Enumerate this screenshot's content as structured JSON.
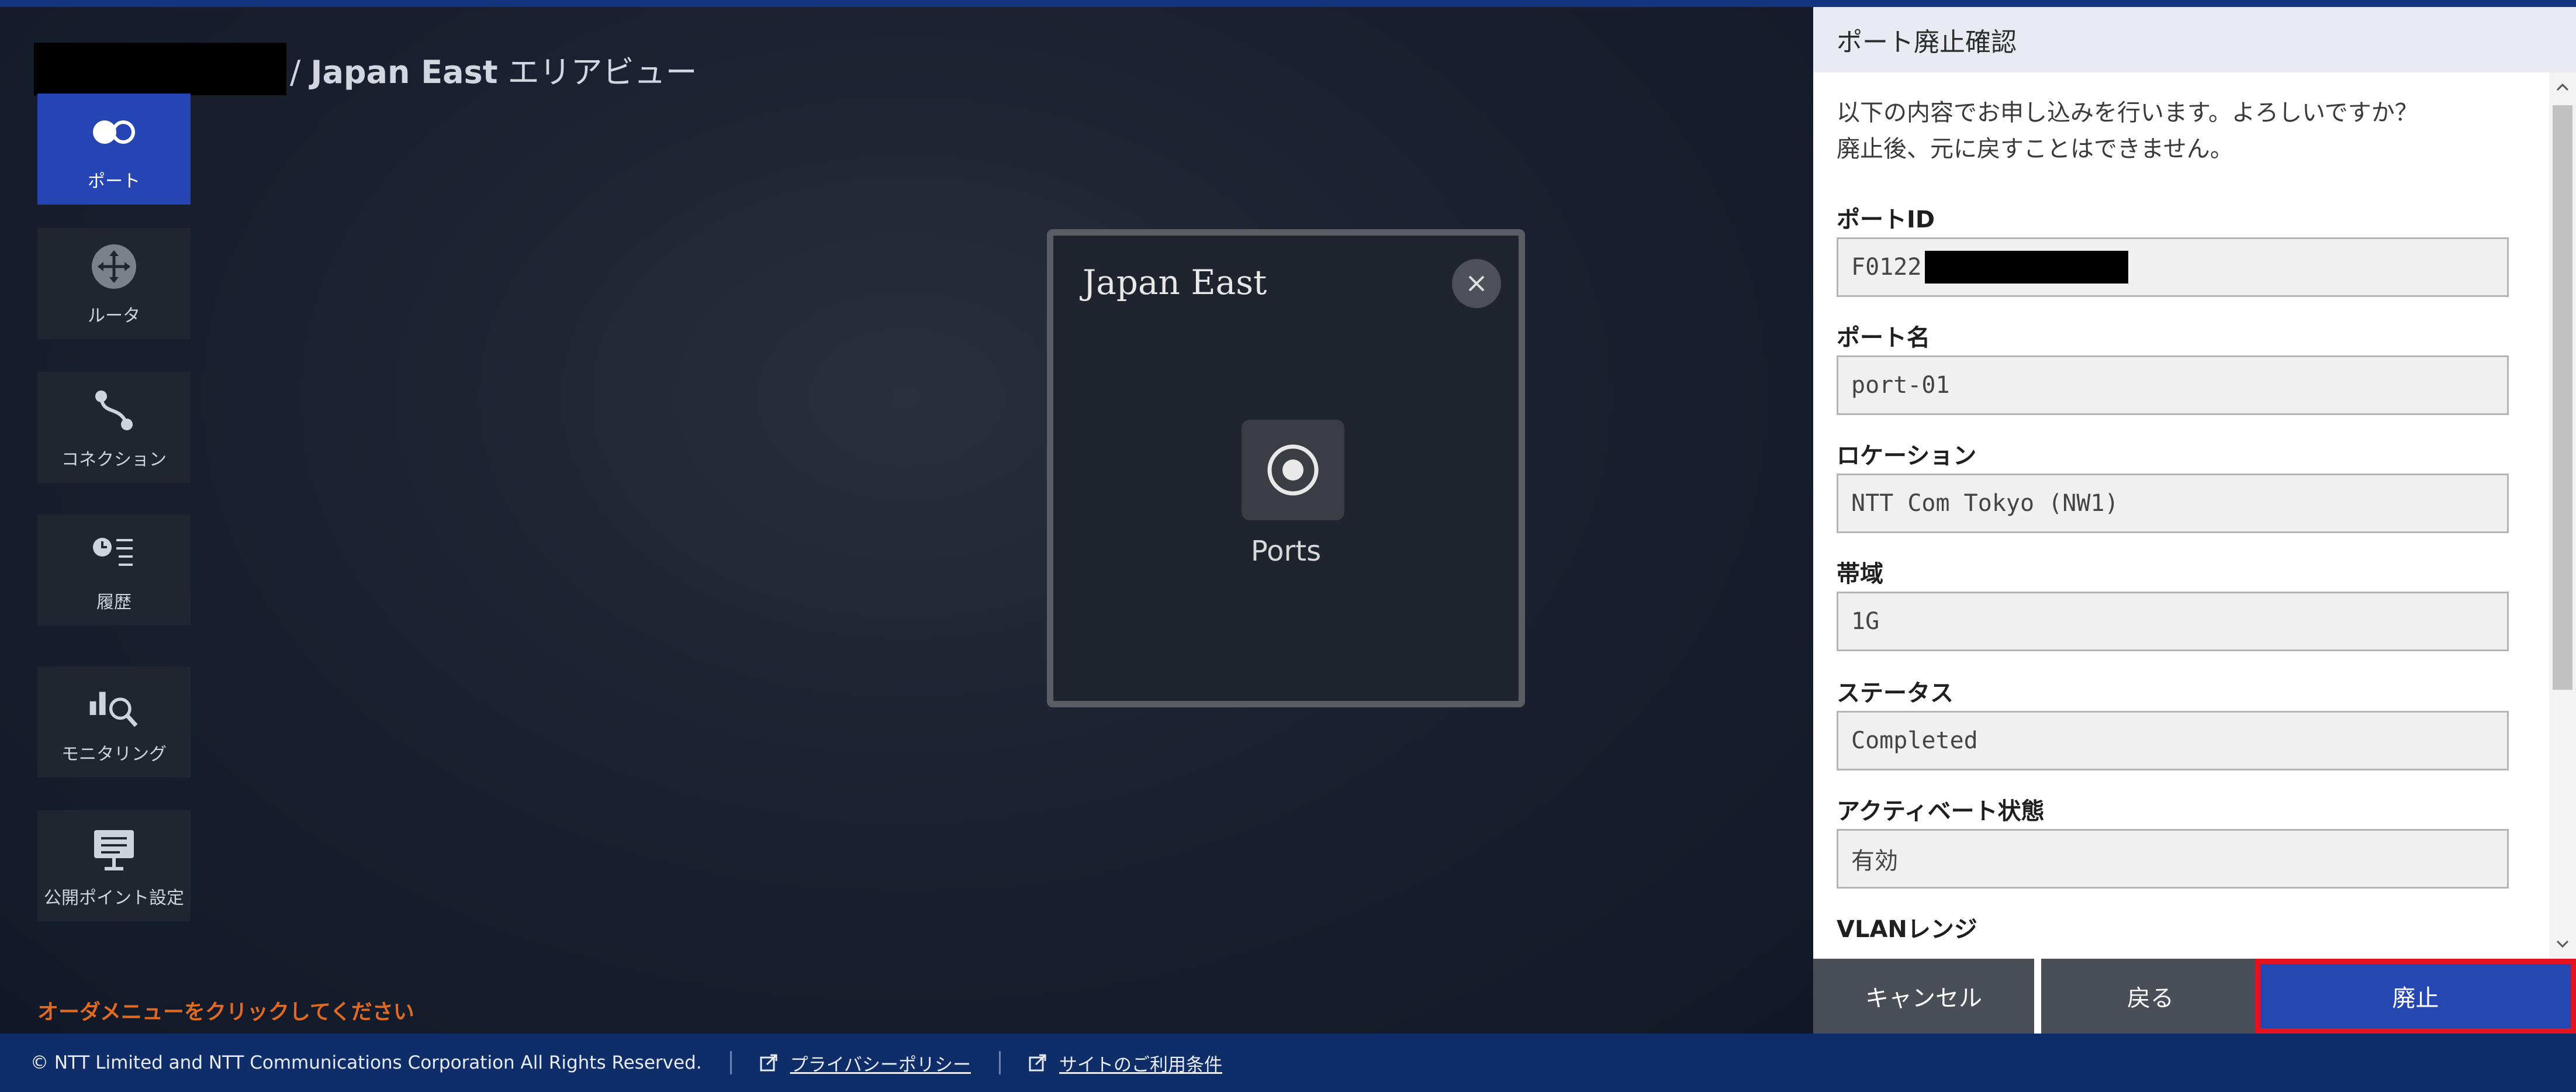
{
  "breadcrumb": {
    "region": "Japan East",
    "view": " エリアビュー"
  },
  "sidebar": {
    "items": [
      {
        "label": "ポート",
        "icon": "ports-icon",
        "active": true
      },
      {
        "label": "ルータ",
        "icon": "router-icon",
        "active": false
      },
      {
        "label": "コネクション",
        "icon": "connection-icon",
        "active": false
      },
      {
        "label": "履歴",
        "icon": "history-icon",
        "active": false
      },
      {
        "label": "モニタリング",
        "icon": "monitoring-icon",
        "active": false
      },
      {
        "label": "公開ポイント設定",
        "icon": "public-point-icon",
        "active": false
      }
    ]
  },
  "order_hint": "オーダメニューをクリックしてください",
  "region_card": {
    "title": "Japan East",
    "tile_label": "Ports"
  },
  "panel": {
    "title": "ポート廃止確認",
    "intro_line1": "以下の内容でお申し込みを行います。よろしいですか？",
    "intro_line2": "廃止後、元に戻すことはできません。",
    "fields": {
      "port_id": {
        "label": "ポートID",
        "value": "F0122"
      },
      "port_name": {
        "label": "ポート名",
        "value": "port-01"
      },
      "location": {
        "label": "ロケーション",
        "value": "NTT Com Tokyo (NW1)"
      },
      "bandwidth": {
        "label": "帯域",
        "value": "1G"
      },
      "status": {
        "label": "ステータス",
        "value": "Completed"
      },
      "activation": {
        "label": "アクティベート状態",
        "value": "有効"
      },
      "vlan": {
        "label": "VLANレンジ"
      }
    },
    "buttons": {
      "cancel": "キャンセル",
      "back": "戻る",
      "retire": "廃止"
    }
  },
  "footer": {
    "copyright": "© NTT Limited and NTT Communications Corporation All Rights Reserved.",
    "privacy": "プライバシーポリシー",
    "terms": "サイトのご利用条件"
  },
  "colors": {
    "accent": "#2545b5",
    "alert_border": "#e4111e",
    "hint": "#e06a1f",
    "footer": "#0f2d68"
  }
}
